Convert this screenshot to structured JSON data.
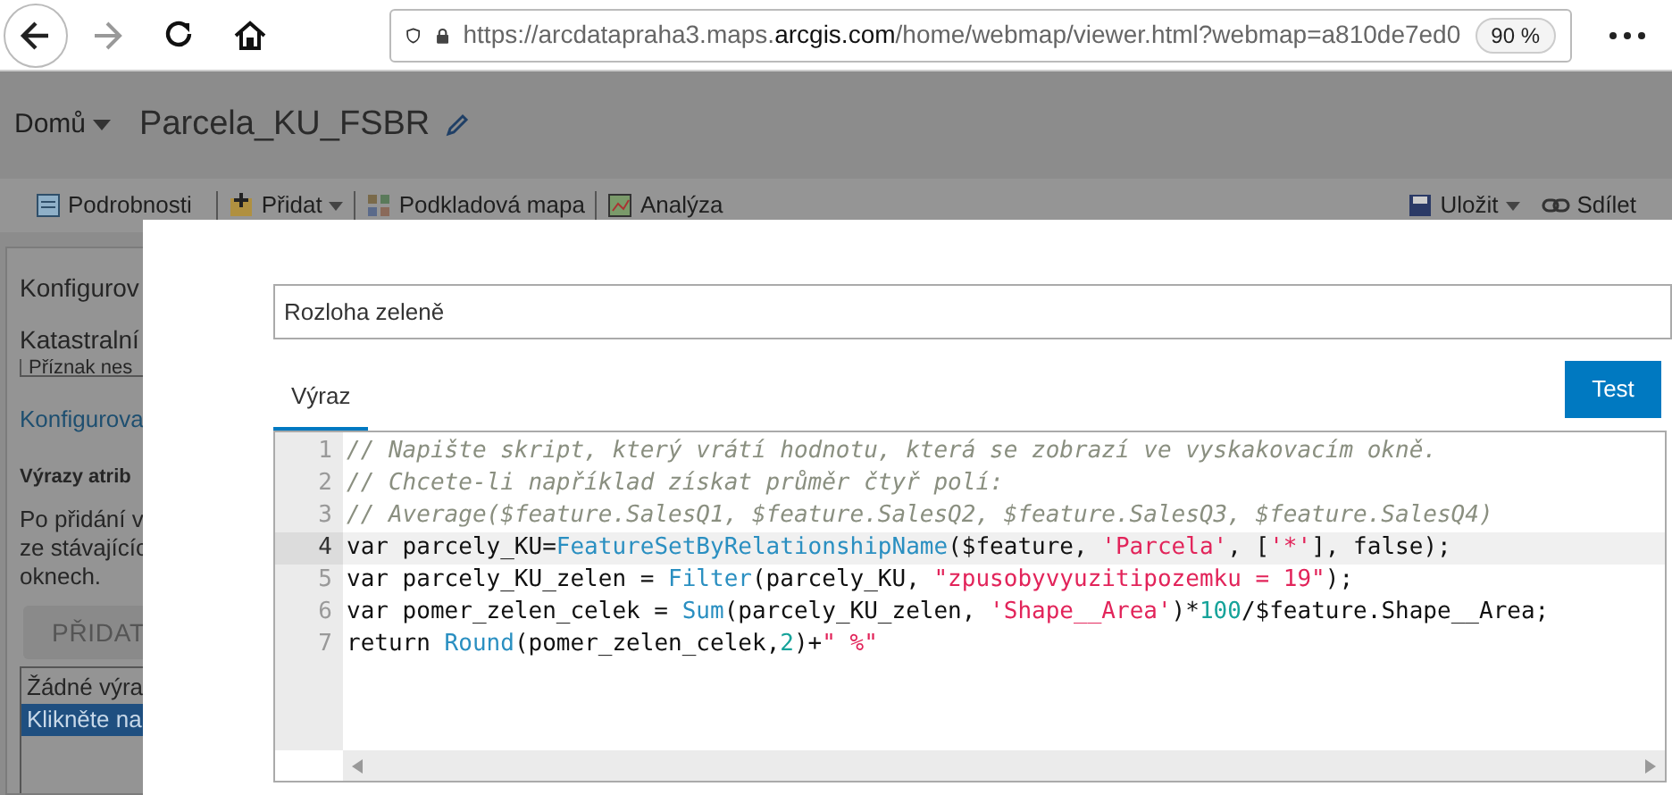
{
  "browser": {
    "url_start": "https://arcdatapraha3.maps.",
    "url_domain": "arcgis.com",
    "url_end": "/home/webmap/viewer.html?webmap=a810de7ed0",
    "zoom": "90 %"
  },
  "header": {
    "home_menu": "Domů",
    "title": "Parcela_KU_FSBR"
  },
  "toolbar": {
    "left": [
      {
        "label": "Podrobnosti",
        "dropdown": false
      },
      {
        "label": "Přidat",
        "dropdown": true
      },
      {
        "label": "Podkladová mapa",
        "dropdown": false
      },
      {
        "label": "Analýza",
        "dropdown": false
      }
    ],
    "right": [
      {
        "label": "Uložit",
        "dropdown": true
      },
      {
        "label": "Sdílet",
        "dropdown": false
      }
    ]
  },
  "sidebar": {
    "heading": "Konfigurov",
    "layer_label": "Katastralní",
    "select_value": "Příznak nes",
    "link": "Konfigurova",
    "section_title": "Výrazy atrib",
    "description": [
      "Po přidání v",
      "ze stávajícíc",
      "oknech."
    ],
    "add_button": "PŘIDAT",
    "list": [
      {
        "label": "Žádné výra",
        "selected": false
      },
      {
        "label": "Klikněte na",
        "selected": true
      }
    ]
  },
  "dialog": {
    "name_field": {
      "value": "Rozloha zeleně"
    },
    "tabs": [
      {
        "label": "Výraz",
        "selected": true
      }
    ],
    "test_button": "Test",
    "editor": {
      "lines": [
        {
          "number": "1",
          "active": false,
          "tokens": [
            {
              "kind": "comment",
              "text": "// Napište skript, který vrátí hodnotu, která se zobrazí ve vyskakovacím okně."
            }
          ]
        },
        {
          "number": "2",
          "active": false,
          "tokens": [
            {
              "kind": "comment",
              "text": "// Chcete-li například získat průměr čtyř polí:"
            }
          ]
        },
        {
          "number": "3",
          "active": false,
          "tokens": [
            {
              "kind": "comment",
              "text": "// Average($feature.SalesQ1, $feature.SalesQ2, $feature.SalesQ3, $feature.SalesQ4)"
            }
          ]
        },
        {
          "number": "4",
          "active": true,
          "tokens": [
            {
              "kind": "plain",
              "text": "var parcely_KU="
            },
            {
              "kind": "function",
              "text": "FeatureSetByRelationshipName"
            },
            {
              "kind": "plain",
              "text": "($feature, "
            },
            {
              "kind": "string",
              "text": "'Parcela'"
            },
            {
              "kind": "plain",
              "text": ", ["
            },
            {
              "kind": "string",
              "text": "'*'"
            },
            {
              "kind": "plain",
              "text": "], false);"
            }
          ]
        },
        {
          "number": "5",
          "active": false,
          "tokens": [
            {
              "kind": "plain",
              "text": "var parcely_KU_zelen = "
            },
            {
              "kind": "function",
              "text": "Filter"
            },
            {
              "kind": "plain",
              "text": "(parcely_KU, "
            },
            {
              "kind": "string",
              "text": "\"zpusobyvyuzitipozemku = 19\""
            },
            {
              "kind": "plain",
              "text": ");"
            }
          ]
        },
        {
          "number": "6",
          "active": false,
          "tokens": [
            {
              "kind": "plain",
              "text": "var pomer_zelen_celek = "
            },
            {
              "kind": "function",
              "text": "Sum"
            },
            {
              "kind": "plain",
              "text": "(parcely_KU_zelen, "
            },
            {
              "kind": "string",
              "text": "'Shape__Area'"
            },
            {
              "kind": "plain",
              "text": ")*"
            },
            {
              "kind": "number",
              "text": "100"
            },
            {
              "kind": "plain",
              "text": "/$feature.Shape__Area;"
            }
          ]
        },
        {
          "number": "7",
          "active": false,
          "tokens": [
            {
              "kind": "plain",
              "text": "return "
            },
            {
              "kind": "function",
              "text": "Round"
            },
            {
              "kind": "plain",
              "text": "(pomer_zelen_celek,"
            },
            {
              "kind": "number",
              "text": "2"
            },
            {
              "kind": "plain",
              "text": ")+"
            },
            {
              "kind": "string",
              "text": "\" %\""
            }
          ]
        }
      ]
    }
  }
}
